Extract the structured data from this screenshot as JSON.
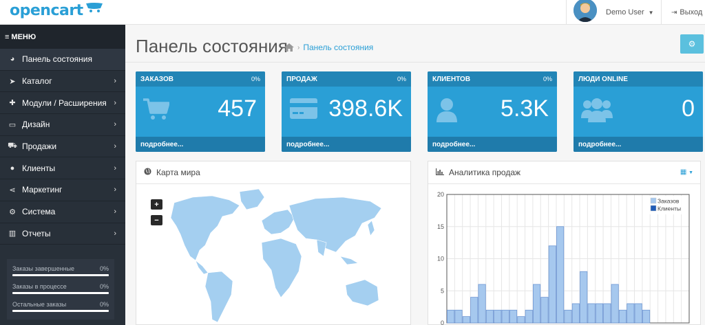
{
  "header": {
    "logo": "opencart",
    "user_name": "Demo User",
    "logout_label": "Выход"
  },
  "sidebar": {
    "menu_label": "МЕНЮ",
    "items": [
      {
        "label": "Панель состояния",
        "icon": "dashboard-icon",
        "chevron": false
      },
      {
        "label": "Каталог",
        "icon": "tags-icon",
        "chevron": true
      },
      {
        "label": "Модули / Расширения",
        "icon": "puzzle-icon",
        "chevron": true
      },
      {
        "label": "Дизайн",
        "icon": "monitor-icon",
        "chevron": true
      },
      {
        "label": "Продажи",
        "icon": "cart-icon",
        "chevron": true
      },
      {
        "label": "Клиенты",
        "icon": "user-icon",
        "chevron": true
      },
      {
        "label": "Маркетинг",
        "icon": "share-icon",
        "chevron": true
      },
      {
        "label": "Система",
        "icon": "gear-icon",
        "chevron": true
      },
      {
        "label": "Отчеты",
        "icon": "bar-chart-icon",
        "chevron": true
      }
    ],
    "progress": [
      {
        "label": "Заказы завершенные",
        "value": "0%",
        "fraction": 0
      },
      {
        "label": "Заказы в процессе",
        "value": "0%",
        "fraction": 0
      },
      {
        "label": "Остальные заказы",
        "value": "0%",
        "fraction": 0
      }
    ]
  },
  "main": {
    "title": "Панель состояния",
    "breadcrumb": "Панель состояния",
    "tiles": [
      {
        "title": "ЗАКАЗОВ",
        "pct": "0%",
        "value": "457",
        "footer": "подробнее...",
        "icon": "cart-icon"
      },
      {
        "title": "ПРОДАЖ",
        "pct": "0%",
        "value": "398.6K",
        "footer": "подробнее...",
        "icon": "credit-card-icon"
      },
      {
        "title": "КЛИЕНТОВ",
        "pct": "0%",
        "value": "5.3K",
        "footer": "подробнее...",
        "icon": "user-icon"
      },
      {
        "title": "ЛЮДИ ONLINE",
        "pct": "",
        "value": "0",
        "footer": "подробнее...",
        "icon": "users-icon"
      }
    ],
    "map_panel": {
      "title": "Карта мира",
      "zoom_in": "+",
      "zoom_out": "−"
    },
    "chart_panel": {
      "title": "Аналитика продаж"
    }
  },
  "colors": {
    "accent": "#2a9fd6",
    "sidebar_bg": "#283039",
    "bar_orders": "#a6c8ee",
    "bar_customers": "#1f5bb6"
  },
  "chart_data": {
    "type": "bar",
    "title": "",
    "xlabel": "",
    "ylabel": "",
    "ylim": [
      0,
      20
    ],
    "yticks": [
      0,
      5,
      10,
      15,
      20
    ],
    "grid": true,
    "legend": "top-right",
    "series": [
      {
        "name": "Заказов",
        "values": [
          2,
          2,
          1,
          4,
          6,
          2,
          2,
          2,
          2,
          1,
          2,
          6,
          4,
          12,
          15,
          2,
          3,
          8,
          3,
          3,
          3,
          6,
          2,
          3,
          3,
          2,
          0,
          0,
          0,
          0,
          0
        ]
      },
      {
        "name": "Клиенты",
        "values": [
          0,
          0,
          0,
          0,
          0,
          0,
          0,
          0,
          0,
          0,
          0,
          0,
          0,
          0,
          0,
          0,
          0,
          0,
          0,
          0,
          0,
          0,
          0,
          0,
          0,
          0,
          0,
          0,
          0,
          0,
          0
        ]
      }
    ]
  }
}
